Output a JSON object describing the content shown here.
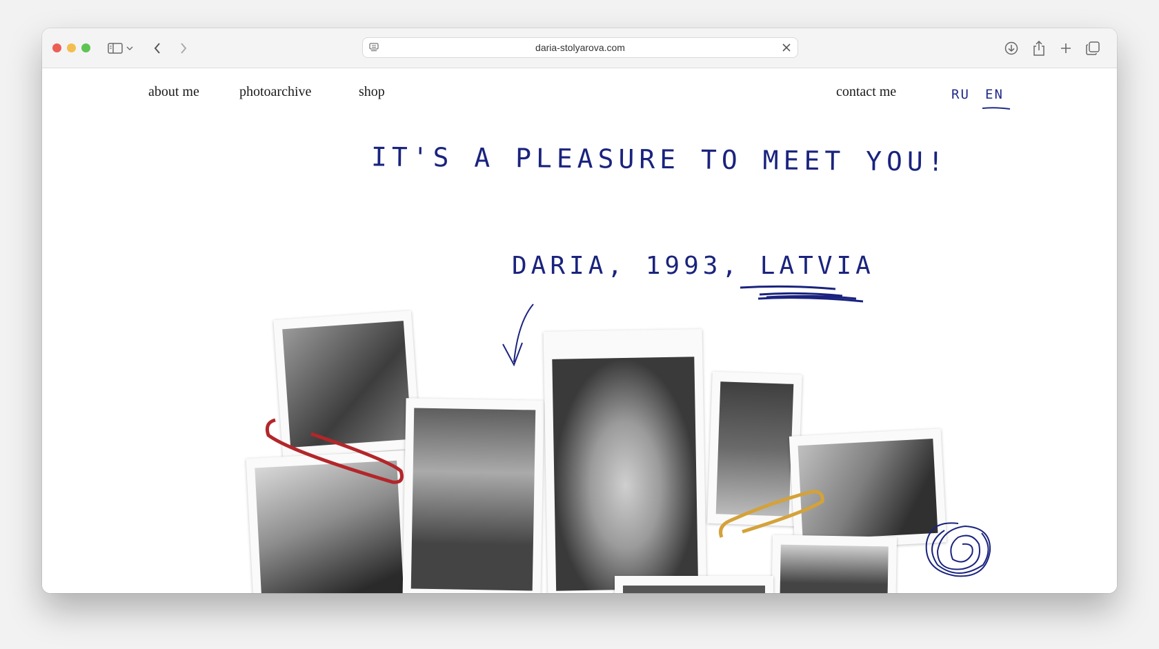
{
  "browser": {
    "url": "daria-stolyarova.com"
  },
  "nav": {
    "about": "about me",
    "archive": "photoarchive",
    "shop": "shop",
    "contact": "contact me",
    "lang_ru": "RU",
    "lang_en": "EN"
  },
  "hero": {
    "headline": "IT'S A PLEASURE TO MEET YOU!",
    "tagline_name": "DARIA,",
    "tagline_year": "1993,",
    "tagline_country": "LATVIA"
  },
  "colors": {
    "ink": "#1a237e",
    "clip_red": "#b3262a",
    "clip_yellow": "#d4a23a"
  },
  "icons": [
    "sidebar-icon",
    "chevron-down-icon",
    "back-icon",
    "forward-icon",
    "page-icon",
    "clear-icon",
    "download-icon",
    "share-icon",
    "new-tab-icon",
    "tabs-overview-icon"
  ]
}
